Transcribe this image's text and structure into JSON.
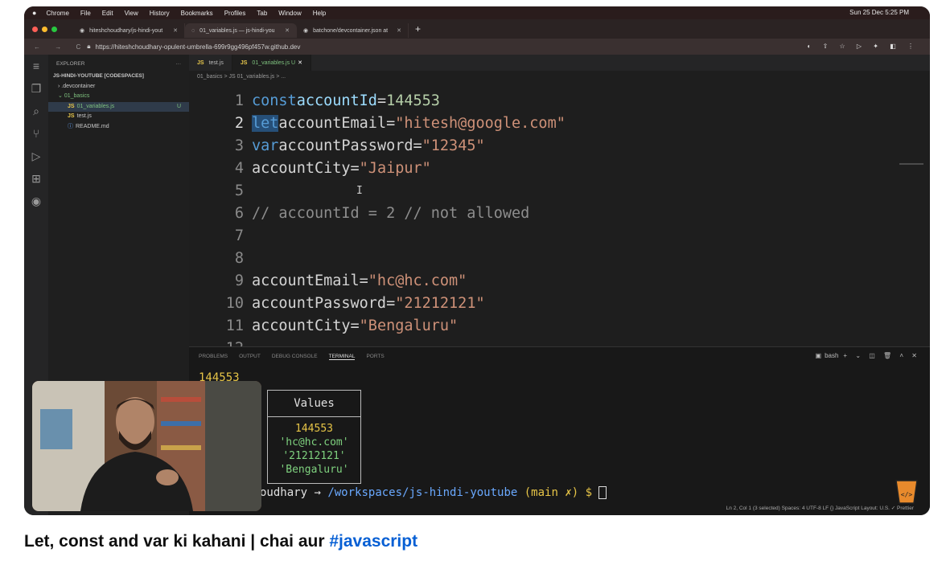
{
  "menubar": {
    "apple": "",
    "items": [
      "Chrome",
      "File",
      "Edit",
      "View",
      "History",
      "Bookmarks",
      "Profiles",
      "Tab",
      "Window",
      "Help"
    ],
    "datetime": "Sun 25 Dec 5:25 PM"
  },
  "browser_tabs": [
    {
      "title": "hiteshchoudhary/js-hindi-yout"
    },
    {
      "title": "01_variables.js — js-hindi-you"
    },
    {
      "title": "batchone/devcontainer.json at"
    }
  ],
  "url": "https://hiteshchoudhary-opulent-umbrella-699r9gg496pf457w.github.dev",
  "explorer": {
    "header": "EXPLORER",
    "root": "JS-HINDI-YOUTUBE [CODESPACES]",
    "items": [
      ".devcontainer",
      "01_basics",
      "01_variables.js",
      "test.js",
      "README.md"
    ],
    "badge": "U"
  },
  "editor_tabs": [
    {
      "label": "test.js"
    },
    {
      "label": "01_variables.js U"
    }
  ],
  "breadcrumb": "01_basics > JS 01_variables.js > ...",
  "code_lines": [
    {
      "n": "1",
      "a": "const",
      "b": " accountId",
      "c": " = ",
      "d": "144553"
    },
    {
      "n": "2",
      "a": "let",
      "b": " accountEmail",
      "c": " = ",
      "d": "\"hitesh@google.com\""
    },
    {
      "n": "3",
      "a": "var",
      "b": " accountPassword",
      "c": " = ",
      "d": "\"12345\""
    },
    {
      "n": "4",
      "a": "",
      "b": "accountCity",
      "c": " = ",
      "d": "\"Jaipur\""
    },
    {
      "n": "5",
      "a": "",
      "b": "",
      "c": "",
      "d": ""
    },
    {
      "n": "6",
      "a": "",
      "b": "",
      "c": "// accountId = 2 // not allowed",
      "d": ""
    },
    {
      "n": "7",
      "a": "",
      "b": "",
      "c": "",
      "d": ""
    },
    {
      "n": "8",
      "a": "",
      "b": "",
      "c": "",
      "d": ""
    },
    {
      "n": "9",
      "a": "",
      "b": "accountEmail",
      "c": " = ",
      "d": "\"hc@hc.com\""
    },
    {
      "n": "10",
      "a": "",
      "b": "accountPassword",
      "c": " = ",
      "d": "\"21212121\""
    },
    {
      "n": "11",
      "a": "",
      "b": "accountCity",
      "c": " = ",
      "d": "\"Bengaluru\""
    },
    {
      "n": "12",
      "a": "",
      "b": "",
      "c": "",
      "d": ""
    }
  ],
  "panel": {
    "tabs": [
      "PROBLEMS",
      "OUTPUT",
      "DEBUG CONSOLE",
      "TERMINAL",
      "PORTS"
    ],
    "shell": "bash",
    "output_first": "144553",
    "table_header": "Values",
    "table_values": [
      "144553",
      "'hc@hc.com'",
      "'21212121'",
      "'Bengaluru'"
    ],
    "prompt_user": "oudhary",
    "prompt_arrow": " → ",
    "prompt_path": "/workspaces/js-hindi-youtube",
    "prompt_branch": " (main ✗) $ "
  },
  "statusbar": "Ln 2, Col 1 (3 selected)   Spaces: 4   UTF-8   LF   {} JavaScript   Layout: U.S.   ✓ Prettier",
  "caption": {
    "text": "Let, const and var ki kahani | chai aur ",
    "hashtag": "#javascript"
  }
}
